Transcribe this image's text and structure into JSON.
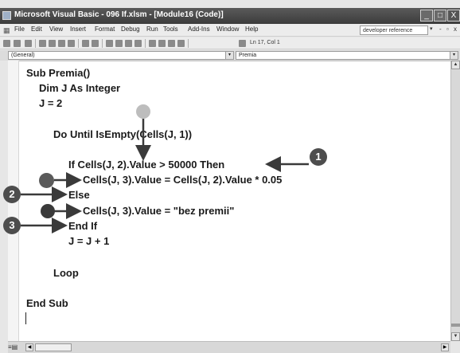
{
  "window": {
    "title": "Microsoft Visual Basic - 096 If.xlsm - [Module16 (Code)]",
    "controls": {
      "minimize": "_",
      "maximize": "□",
      "close": "X"
    }
  },
  "menu": {
    "items": [
      "File",
      "Edit",
      "View",
      "Insert",
      "Format",
      "Debug",
      "Run",
      "Tools",
      "Add-Ins",
      "Window",
      "Help"
    ],
    "help_search": "developer reference",
    "mdi_controls": [
      "-",
      "▫",
      "x"
    ]
  },
  "toolbar": {
    "cursor_position": "Ln 17, Col 1"
  },
  "code_window": {
    "object_combo": "(General)",
    "procedure_combo": "Premia"
  },
  "code": {
    "lines": [
      "Sub Premia()",
      "Dim J As Integer",
      "J = 2",
      "Do Until IsEmpty(Cells(J, 1))",
      "If Cells(J, 2).Value > 50000 Then",
      "Cells(J, 3).Value = Cells(J, 2).Value * 0.05",
      "Else",
      "Cells(J, 3).Value = \"bez premii\"",
      "End If",
      "J = J + 1",
      "Loop",
      "End Sub"
    ]
  },
  "callouts": [
    "1",
    "2",
    "3"
  ],
  "colors": {
    "callout": "#4d4d4d",
    "dot_light": "#bdbdbd",
    "dot_dark": "#4a4a4a",
    "titlebar": "#3c3c3c"
  }
}
